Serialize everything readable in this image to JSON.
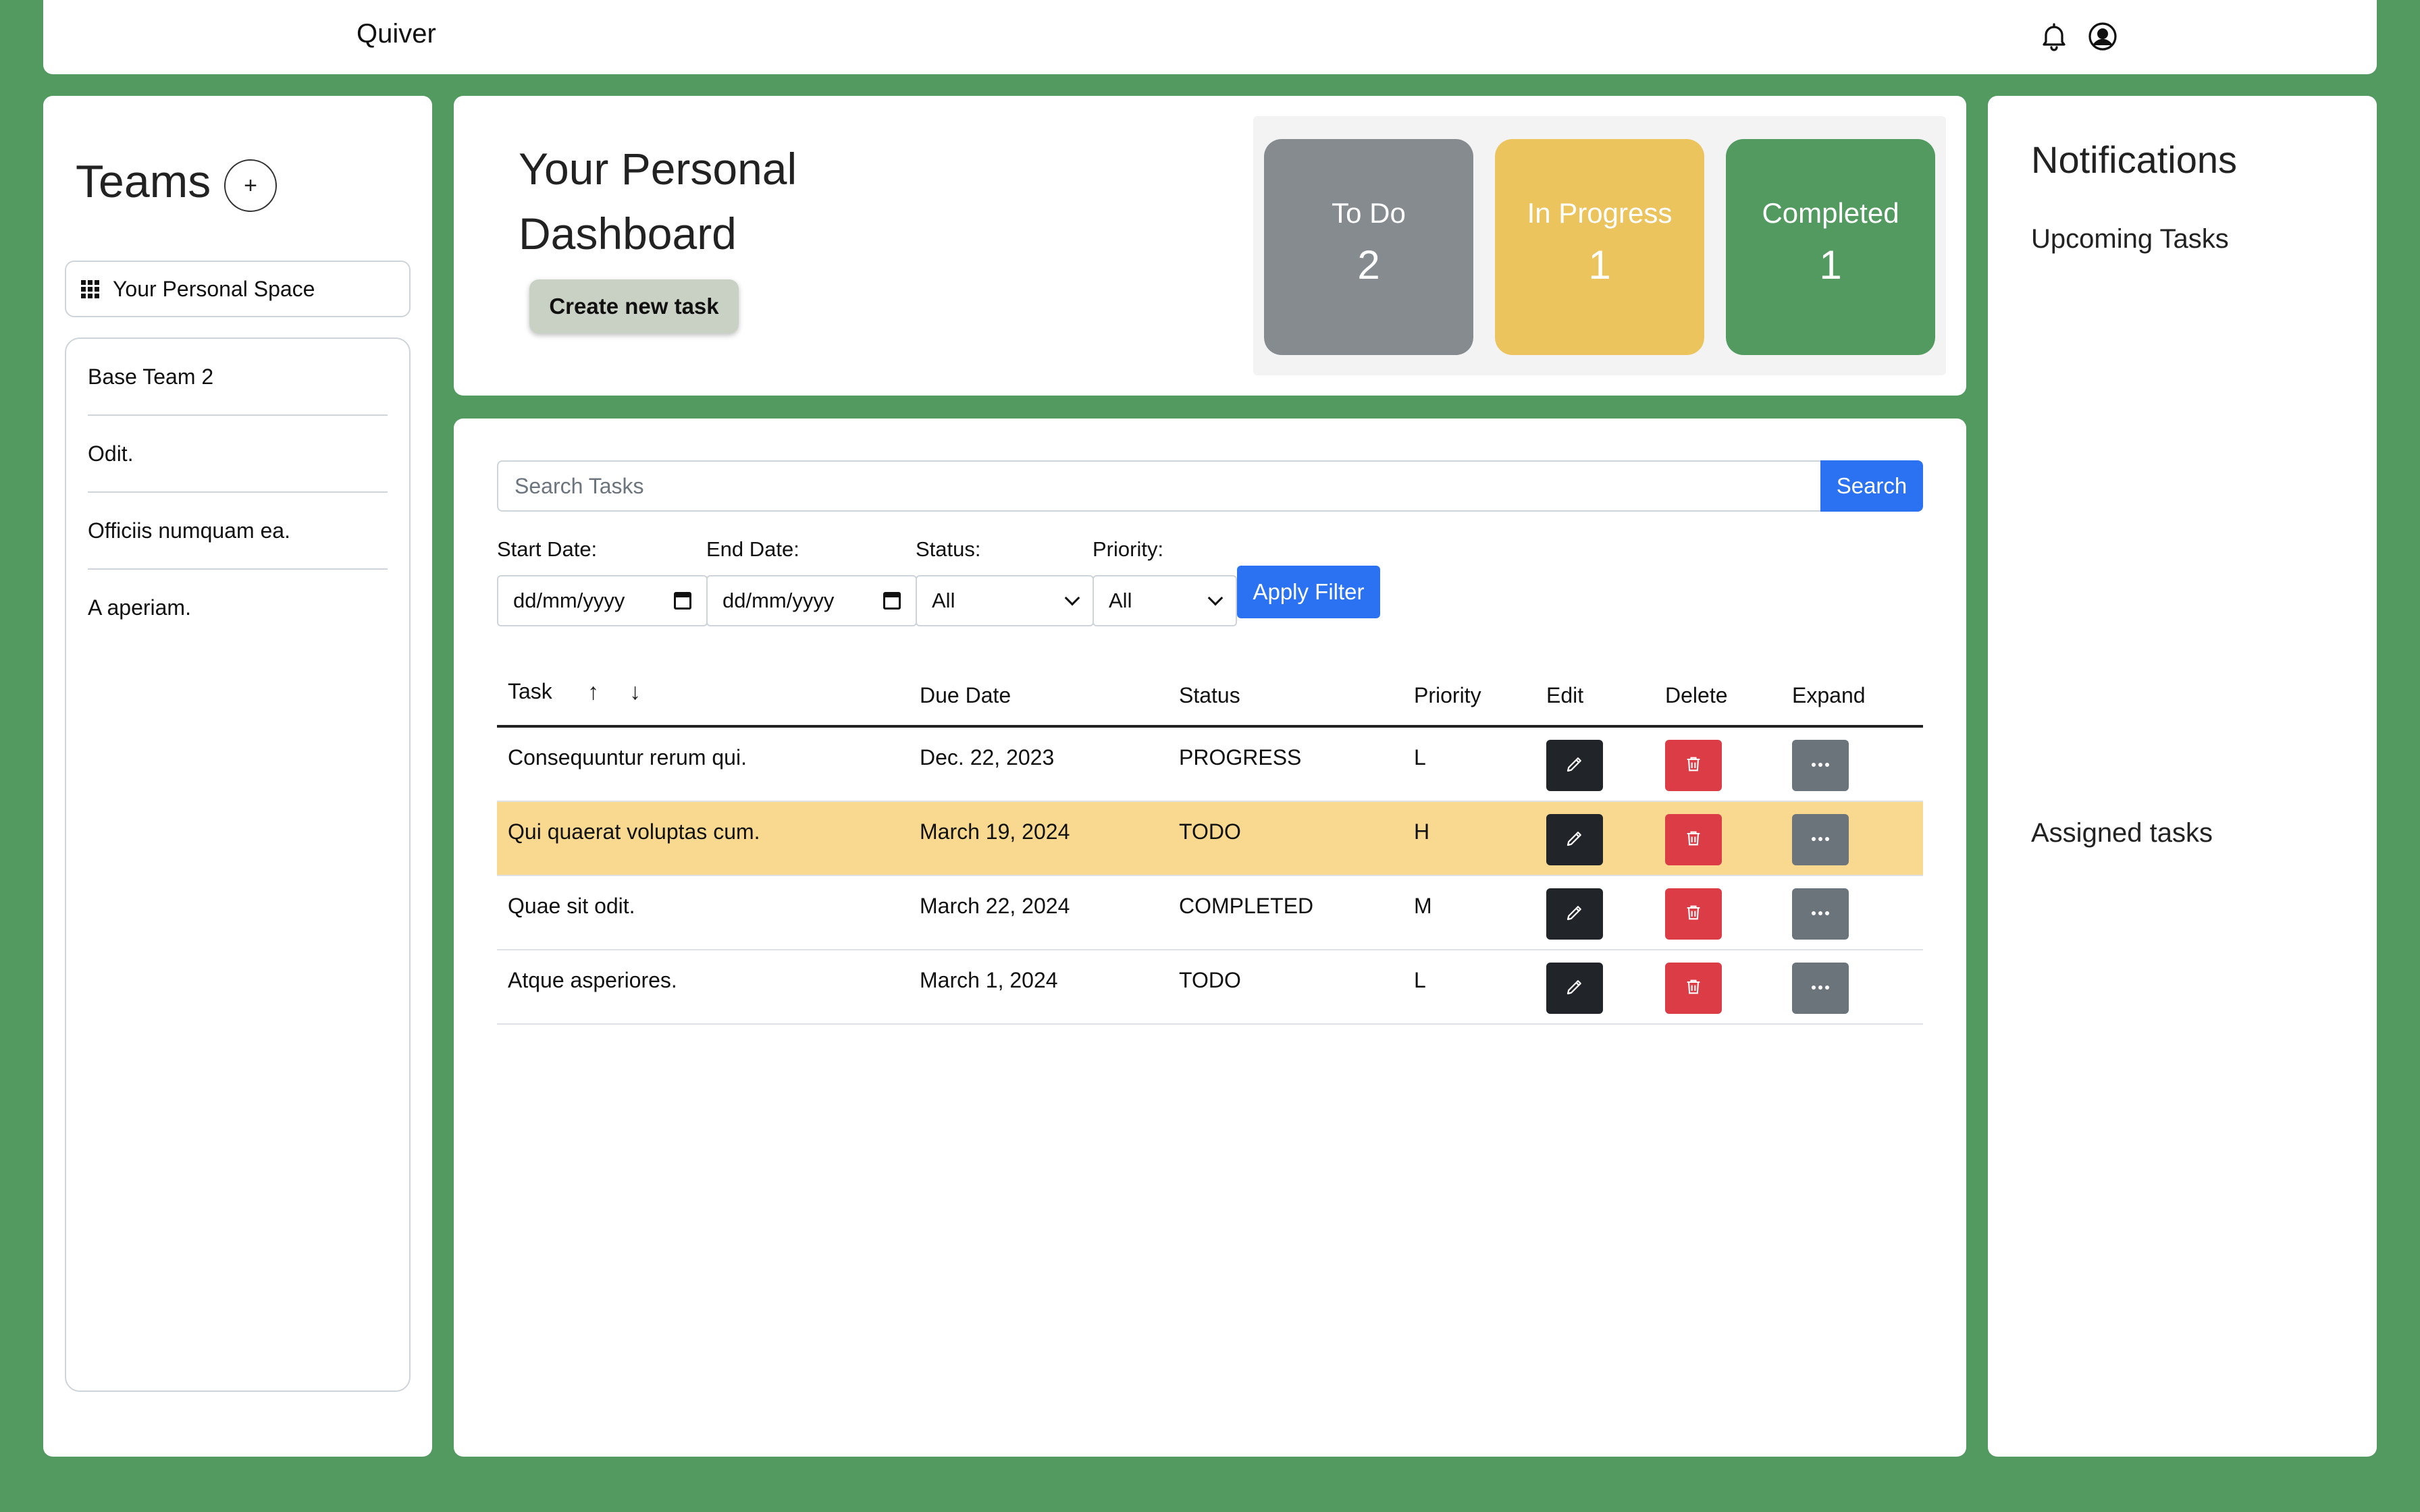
{
  "app": {
    "title": "Quiver"
  },
  "nav": {
    "bell_icon": "bell-icon",
    "user_icon": "user-circle-icon"
  },
  "sidebar": {
    "title": "Teams",
    "add_label": "+",
    "personal_space": "Your Personal Space",
    "teams": [
      "Base Team 2",
      "Odit.",
      "Officiis numquam ea.",
      "A aperiam."
    ]
  },
  "dashboard": {
    "title": "Your Personal Dashboard",
    "create_label": "Create new task",
    "stats": [
      {
        "label": "To Do",
        "value": "2",
        "color": "#868b90"
      },
      {
        "label": "In Progress",
        "value": "1",
        "color": "#ecc45e"
      },
      {
        "label": "Completed",
        "value": "1",
        "color": "#539a61"
      }
    ]
  },
  "search": {
    "placeholder": "Search Tasks",
    "button_label": "Search"
  },
  "filters": {
    "start_label": "Start Date:",
    "start_value": "dd/mm/yyyy",
    "end_label": "End Date:",
    "end_value": "dd/mm/yyyy",
    "status_label": "Status:",
    "status_value": "All",
    "priority_label": "Priority:",
    "priority_value": "All",
    "apply_label": "Apply Filter"
  },
  "table": {
    "headers": [
      "Task",
      "Due Date",
      "Status",
      "Priority",
      "Edit",
      "Delete",
      "Expand"
    ],
    "sort_up": "↑",
    "sort_down": "↓",
    "rows": [
      {
        "task": "Consequuntur rerum qui.",
        "due": "Dec. 22, 2023",
        "status": "PROGRESS",
        "priority": "L"
      },
      {
        "task": "Qui quaerat voluptas cum.",
        "due": "March 19, 2024",
        "status": "TODO",
        "priority": "H"
      },
      {
        "task": "Quae sit odit.",
        "due": "March 22, 2024",
        "status": "COMPLETED",
        "priority": "M"
      },
      {
        "task": "Atque asperiores.",
        "due": "March 1, 2024",
        "status": "TODO",
        "priority": "L"
      }
    ],
    "highlight_color": "#f8d98f"
  },
  "notifications": {
    "title": "Notifications",
    "upcoming": "Upcoming Tasks",
    "assigned": "Assigned tasks"
  },
  "colors": {
    "background": "#539a61",
    "primary": "#2a72f2",
    "danger": "#dc3c46"
  }
}
